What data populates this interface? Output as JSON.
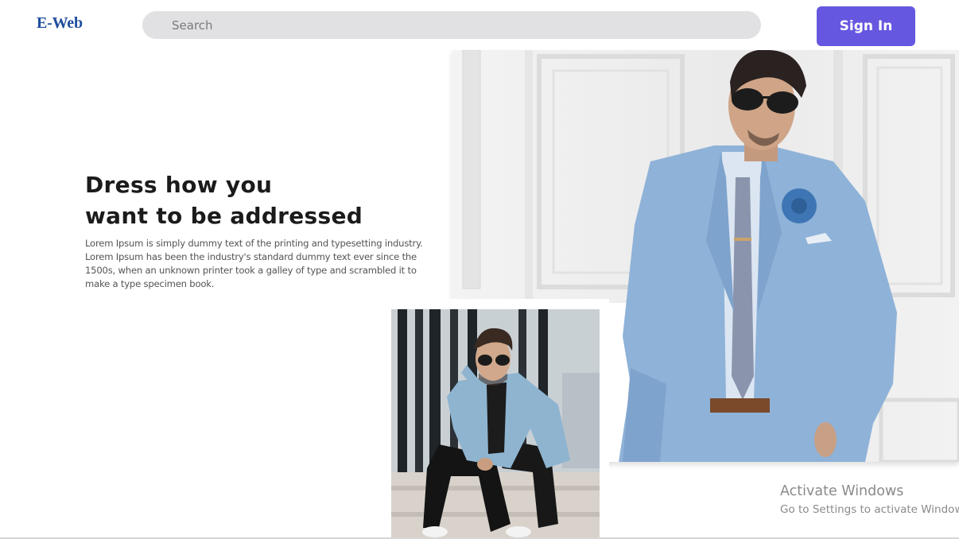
{
  "header": {
    "logo": "E-Web",
    "search_placeholder": "Search",
    "signin_label": "Sign In"
  },
  "hero": {
    "headline_line1": "Dress how you",
    "headline_line2": "want to be addressed",
    "body": "Lorem Ipsum is simply dummy text of the printing and typesetting industry. Lorem Ipsum has been the industry's standard dummy text ever since the 1500s, when an unknown printer took a galley of type and scrambled it to make a type specimen book."
  },
  "watermark": {
    "title": "Activate Windows",
    "subtitle": "Go to Settings to activate Windows."
  },
  "colors": {
    "accent": "#6557e0",
    "logo": "#1f4e9c",
    "search_bg": "#e1e1e3",
    "suit": "#8fb2d8"
  }
}
